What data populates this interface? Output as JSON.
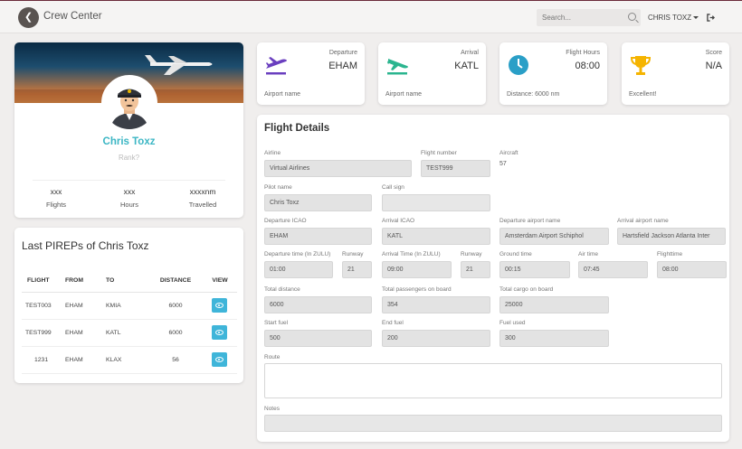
{
  "header": {
    "title": "Crew Center",
    "search_placeholder": "Search...",
    "user": "CHRIS TOXZ"
  },
  "profile": {
    "name": "Chris Toxz",
    "rank": "Rank?",
    "stats": [
      {
        "value": "xxx",
        "label": "Flights"
      },
      {
        "value": "xxx",
        "label": "Hours"
      },
      {
        "value": "xxxxnm",
        "label": "Travelled"
      }
    ]
  },
  "pireps": {
    "title": "Last PIREPs of Chris Toxz",
    "columns": [
      "FLIGHT",
      "FROM",
      "TO",
      "DISTANCE",
      "VIEW"
    ],
    "rows": [
      {
        "flight": "TEST003",
        "from": "EHAM",
        "to": "KMIA",
        "distance": "6000"
      },
      {
        "flight": "TEST999",
        "from": "EHAM",
        "to": "KATL",
        "distance": "6000"
      },
      {
        "flight": "1231",
        "from": "EHAM",
        "to": "KLAX",
        "distance": "56"
      }
    ]
  },
  "info_cards": {
    "departure": {
      "label": "Departure",
      "value": "EHAM",
      "footer": "Airport name",
      "icon": "departure-icon",
      "color": "#6a3fbf"
    },
    "arrival": {
      "label": "Arrival",
      "value": "KATL",
      "footer": "Airport name",
      "icon": "arrival-icon",
      "color": "#2bb58f"
    },
    "hours": {
      "label": "Flight Hours",
      "value": "08:00",
      "footer": "Distance: 6000 nm",
      "icon": "clock-icon",
      "color": "#2a9fc7"
    },
    "score": {
      "label": "Score",
      "value": "N/A",
      "footer": "Excellent!",
      "icon": "trophy-icon",
      "color": "#f5b400"
    }
  },
  "details": {
    "title": "Flight Details",
    "airline_label": "Airline",
    "airline": "Virtual Airlines",
    "flight_number_label": "Flight number",
    "flight_number": "TEST999",
    "aircraft_label": "Aircraft",
    "aircraft": "57",
    "pilot_name_label": "Pilot name",
    "pilot_name": "Chris Toxz",
    "callsign_label": "Call sign",
    "callsign": "",
    "dep_icao_label": "Departure ICAO",
    "dep_icao": "EHAM",
    "arr_icao_label": "Arrival ICAO",
    "arr_icao": "KATL",
    "dep_airport_label": "Departure airport name",
    "dep_airport": "Amsterdam Airport Schiphol",
    "arr_airport_label": "Arrival airport name",
    "arr_airport": "Hartsfield Jackson Atlanta Inter",
    "dep_time_label": "Departure time (In ZULU)",
    "dep_time": "01:00",
    "dep_runway_label": "Runway",
    "dep_runway": "21",
    "arr_time_label": "Arrival Time (In ZULU)",
    "arr_time": "09:00",
    "arr_runway_label": "Runway",
    "arr_runway": "21",
    "ground_time_label": "Ground time",
    "ground_time": "00:15",
    "air_time_label": "Air time",
    "air_time": "07:45",
    "flighttime_label": "Flighttime",
    "flighttime": "08:00",
    "total_distance_label": "Total distance",
    "total_distance": "6000",
    "pax_label": "Total passengers on board",
    "pax": "354",
    "cargo_label": "Total cargo on board",
    "cargo": "25000",
    "start_fuel_label": "Start fuel",
    "start_fuel": "500",
    "end_fuel_label": "End fuel",
    "end_fuel": "200",
    "fuel_used_label": "Fuel used",
    "fuel_used": "300",
    "route_label": "Route",
    "route": "",
    "notes_label": "Notes",
    "notes": ""
  }
}
